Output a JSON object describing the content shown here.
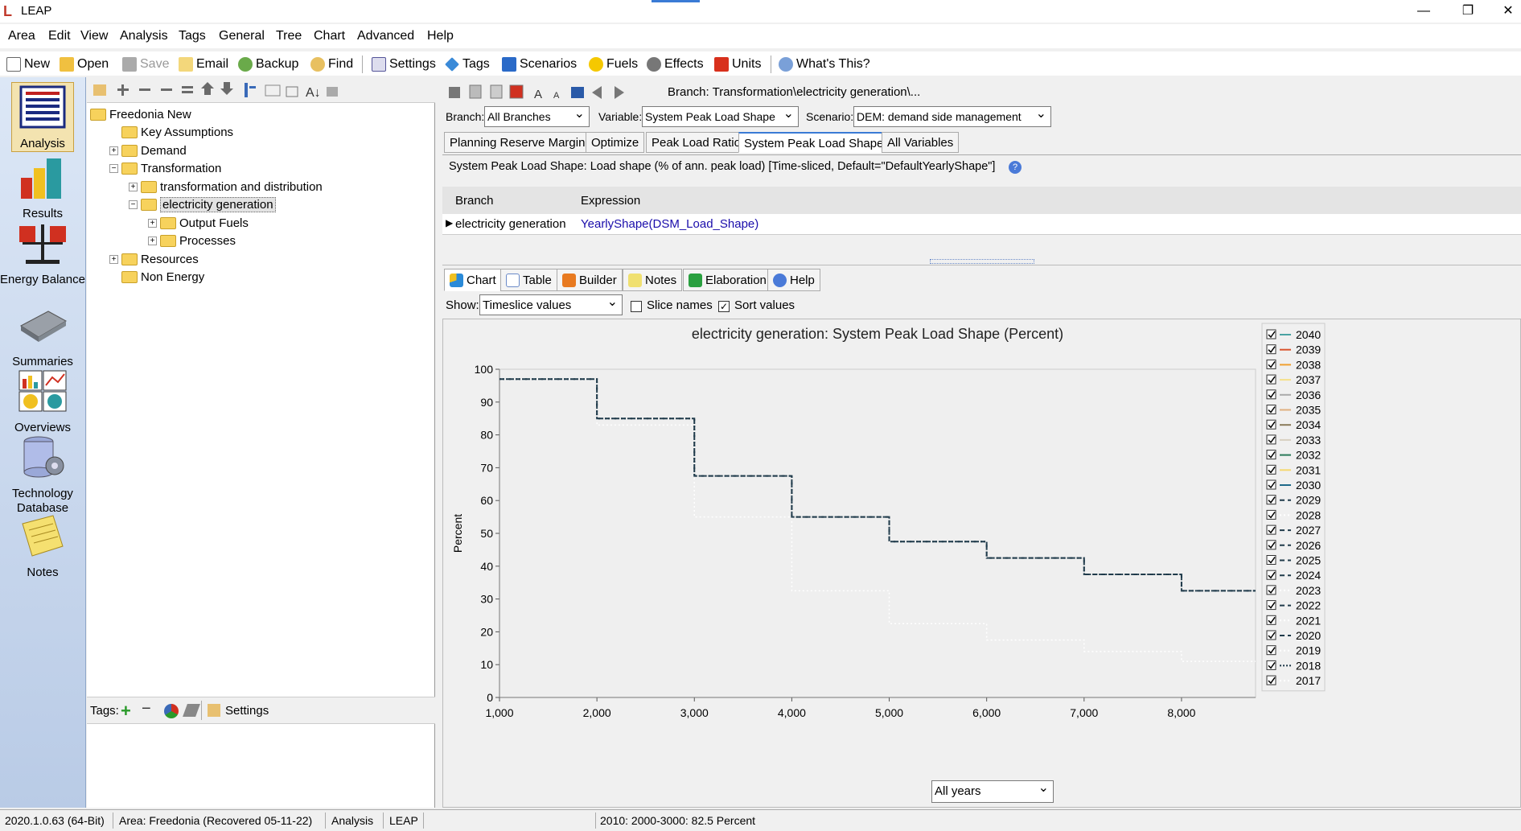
{
  "window": {
    "title": "LEAP"
  },
  "menu": [
    "Area",
    "Edit",
    "View",
    "Analysis",
    "Tags",
    "General",
    "Tree",
    "Chart",
    "Advanced",
    "Help"
  ],
  "toolbar": {
    "new": "New",
    "open": "Open",
    "save": "Save",
    "email": "Email",
    "backup": "Backup",
    "find": "Find",
    "settings": "Settings",
    "tags": "Tags",
    "scenarios": "Scenarios",
    "fuels": "Fuels",
    "effects": "Effects",
    "units": "Units",
    "whats_this": "What's This?"
  },
  "nav": [
    "Analysis",
    "Results",
    "Energy Balance",
    "Summaries",
    "Overviews",
    "Technology Database",
    "Notes"
  ],
  "tree": [
    {
      "label": "Freedonia New",
      "level": 0,
      "expander": ""
    },
    {
      "label": "Key Assumptions",
      "level": 1,
      "expander": ""
    },
    {
      "label": "Demand",
      "level": 1,
      "expander": "+"
    },
    {
      "label": "Transformation",
      "level": 1,
      "expander": "−"
    },
    {
      "label": "transformation and distribution",
      "level": 2,
      "expander": "+"
    },
    {
      "label": "electricity generation",
      "level": 2,
      "expander": "−",
      "selected": true
    },
    {
      "label": "Output Fuels",
      "level": 3,
      "expander": "+"
    },
    {
      "label": "Processes",
      "level": 3,
      "expander": "+"
    },
    {
      "label": "Resources",
      "level": 1,
      "expander": "+"
    },
    {
      "label": "Non Energy",
      "level": 1,
      "expander": ""
    }
  ],
  "tagsbar": {
    "label": "Tags:",
    "settings": "Settings"
  },
  "branch_path": "Branch: Transformation\\electricity generation\\...",
  "selectors": {
    "branch_label": "Branch:",
    "branch_value": "All Branches",
    "variable_label": "Variable:",
    "variable_value": "System Peak Load Shape",
    "scenario_label": "Scenario:",
    "scenario_value": "DEM: demand side management"
  },
  "variable_tabs": [
    "Planning Reserve Margin",
    "Optimize",
    "Peak Load Ratio",
    "System Peak Load Shape",
    "All Variables"
  ],
  "description": "System Peak Load Shape: Load shape (% of ann. peak load) [Time-sliced, Default=\"DefaultYearlyShape\"]",
  "grid": {
    "headers": [
      "Branch",
      "Expression"
    ],
    "row": {
      "branch": "electricity generation",
      "expression": "YearlyShape(DSM_Load_Shape)"
    }
  },
  "chart_tabs": [
    "Chart",
    "Table",
    "Builder",
    "Notes",
    "Elaboration",
    "Help"
  ],
  "show": {
    "label": "Show:",
    "value": "Timeslice values",
    "slice_names": "Slice names",
    "sort_values": "Sort values"
  },
  "years_select": "All years",
  "status": {
    "version": "2020.1.0.63 (64-Bit)",
    "area": "Area: Freedonia (Recovered 05-11-22)",
    "view": "Analysis",
    "app": "LEAP",
    "info": "2010: 2000-3000: 82.5 Percent"
  },
  "colors": {
    "nav_bg": "#c8d7ee",
    "link": "#1a0dab",
    "series_dark": "#1f3a4a"
  },
  "chart_data": {
    "type": "line",
    "title": "electricity generation: System Peak Load Shape (Percent)",
    "ylabel": "Percent",
    "xlabel": "",
    "xlim": [
      1000,
      8760
    ],
    "ylim": [
      0,
      100
    ],
    "xticks": [
      "1,000",
      "2,000",
      "3,000",
      "4,000",
      "5,000",
      "6,000",
      "7,000",
      "8,000"
    ],
    "yticks": [
      "0",
      "10",
      "20",
      "30",
      "40",
      "50",
      "60",
      "70",
      "80",
      "90",
      "100"
    ],
    "legend": [
      "2040",
      "2039",
      "2038",
      "2037",
      "2036",
      "2035",
      "2034",
      "2033",
      "2032",
      "2031",
      "2030",
      "2029",
      "2028",
      "2027",
      "2026",
      "2025",
      "2024",
      "2023",
      "2022",
      "2021",
      "2020",
      "2019",
      "2018",
      "2017"
    ],
    "legend_colors": [
      "#4aa3a3",
      "#d9532c",
      "#f0a030",
      "#f5e08a",
      "#aaaaaa",
      "#e0b080",
      "#8a7a5a",
      "#d8d0c0",
      "#2a7a5a",
      "#f5d870",
      "#1f6a8a",
      "#1f3a4a",
      "#ffffff",
      "#1f3a4a",
      "#1f3a4a",
      "#1f3a4a",
      "#1f3a4a",
      "#ffffff",
      "#1f3a4a",
      "#ffffff",
      "#1f3a4a",
      "#ffffff",
      "#1f3a4a",
      "#ffffff"
    ],
    "legend_dash": [
      "",
      "",
      "",
      "",
      "",
      "",
      "",
      "",
      "",
      "",
      "",
      "6,4",
      "2,3",
      "6,4",
      "6,4",
      "6,4",
      "6,4",
      "2,3",
      "6,4",
      "2,3",
      "6,4",
      "2,3",
      "2,2",
      "2,3"
    ],
    "series": [
      {
        "name": "2018",
        "step": true,
        "x": [
          1000,
          2000,
          3000,
          4000,
          5000,
          6000,
          7000,
          8000,
          8760
        ],
        "y": [
          97,
          85,
          67.5,
          55,
          47.5,
          42.5,
          37.5,
          32.5,
          32.5
        ],
        "color": "#1f3a4a",
        "dash": "2,2"
      },
      {
        "name": "2029",
        "step": true,
        "x": [
          1000,
          2000,
          3000,
          4000,
          5000,
          6000,
          7000,
          8000,
          8760
        ],
        "y": [
          97,
          85,
          67.5,
          55,
          47.5,
          42.5,
          37.5,
          32.5,
          32.5
        ],
        "color": "#1f3a4a",
        "dash": "6,4"
      },
      {
        "name": "2017",
        "step": true,
        "x": [
          1000,
          2000,
          3000,
          4000,
          5000,
          6000,
          7000,
          8000,
          8760
        ],
        "y": [
          97,
          83,
          55,
          32.5,
          22.5,
          17.5,
          14,
          11,
          11
        ],
        "color": "#ffffff",
        "dash": "2,3"
      }
    ]
  }
}
